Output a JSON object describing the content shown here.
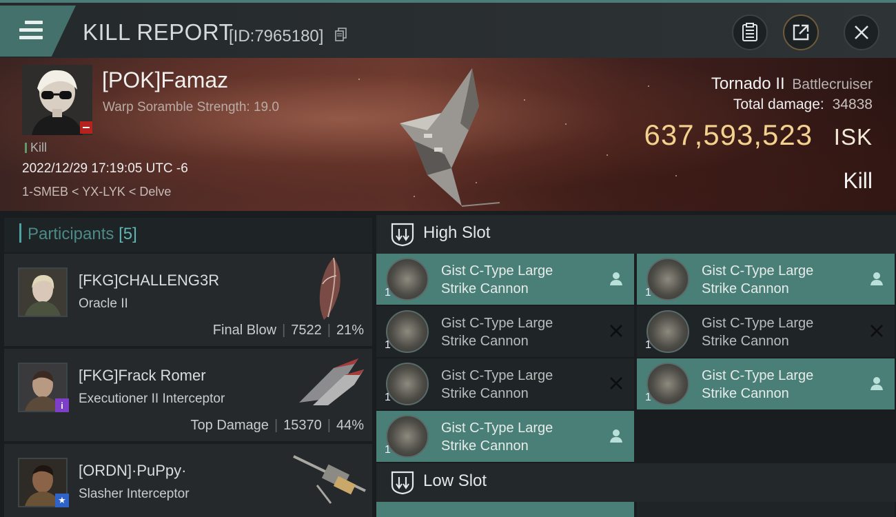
{
  "header": {
    "title": "KILL REPORT",
    "report_id": "[ID:7965180]"
  },
  "victim": {
    "name": "[POK]Famaz",
    "scramble": "Warp Soramble Strength: 19.0",
    "kill_tag": "Kill",
    "datetime": "2022/12/29 17:19:05 UTC -6",
    "location": "1-SMEB < YX-LYK < Delve",
    "ship": "Tornado II",
    "ship_class": "Battlecruiser",
    "total_damage_label": "Total damage:",
    "total_damage": "34838",
    "isk_value": "637,593,523",
    "isk_unit": "ISK",
    "result": "Kill"
  },
  "participants": {
    "label": "Participants",
    "count": "[5]",
    "items": [
      {
        "name": "[FKG]CHALLENG3R",
        "ship": "Oracle II",
        "stat_label": "Final Blow",
        "damage": "7522",
        "percent": "21%"
      },
      {
        "name": "[FKG]Frack Romer",
        "ship": "Executioner II Interceptor",
        "stat_label": "Top Damage",
        "damage": "15370",
        "percent": "44%"
      },
      {
        "name": "[ORDN]·PuPpy·",
        "ship": "Slasher Interceptor",
        "stat_label": "",
        "damage": "",
        "percent": ""
      }
    ]
  },
  "high_slot": {
    "label": "High Slot",
    "items": [
      {
        "line1": "Gist C-Type Large",
        "line2": "Strike Cannon",
        "qty": "1",
        "state": "active"
      },
      {
        "line1": "Gist C-Type Large",
        "line2": "Strike Cannon",
        "qty": "1",
        "state": "active"
      },
      {
        "line1": "Gist C-Type Large",
        "line2": "Strike Cannon",
        "qty": "1",
        "state": "destroyed"
      },
      {
        "line1": "Gist C-Type Large",
        "line2": "Strike Cannon",
        "qty": "1",
        "state": "destroyed"
      },
      {
        "line1": "Gist C-Type Large",
        "line2": "Strike Cannon",
        "qty": "1",
        "state": "destroyed"
      },
      {
        "line1": "Gist C-Type Large",
        "line2": "Strike Cannon",
        "qty": "1",
        "state": "active"
      },
      {
        "line1": "Gist C-Type Large",
        "line2": "Strike Cannon",
        "qty": "1",
        "state": "active"
      }
    ]
  },
  "low_slot": {
    "label": "Low Slot"
  },
  "colors": {
    "accent": "#4a7f78",
    "isk": "#f3d18e",
    "header_accent": "#4d7c78"
  },
  "icons": [
    "hamburger-icon",
    "copy-icon",
    "clipboard-icon",
    "share-icon",
    "close-icon",
    "slot-icon",
    "person-icon",
    "cross-icon"
  ]
}
